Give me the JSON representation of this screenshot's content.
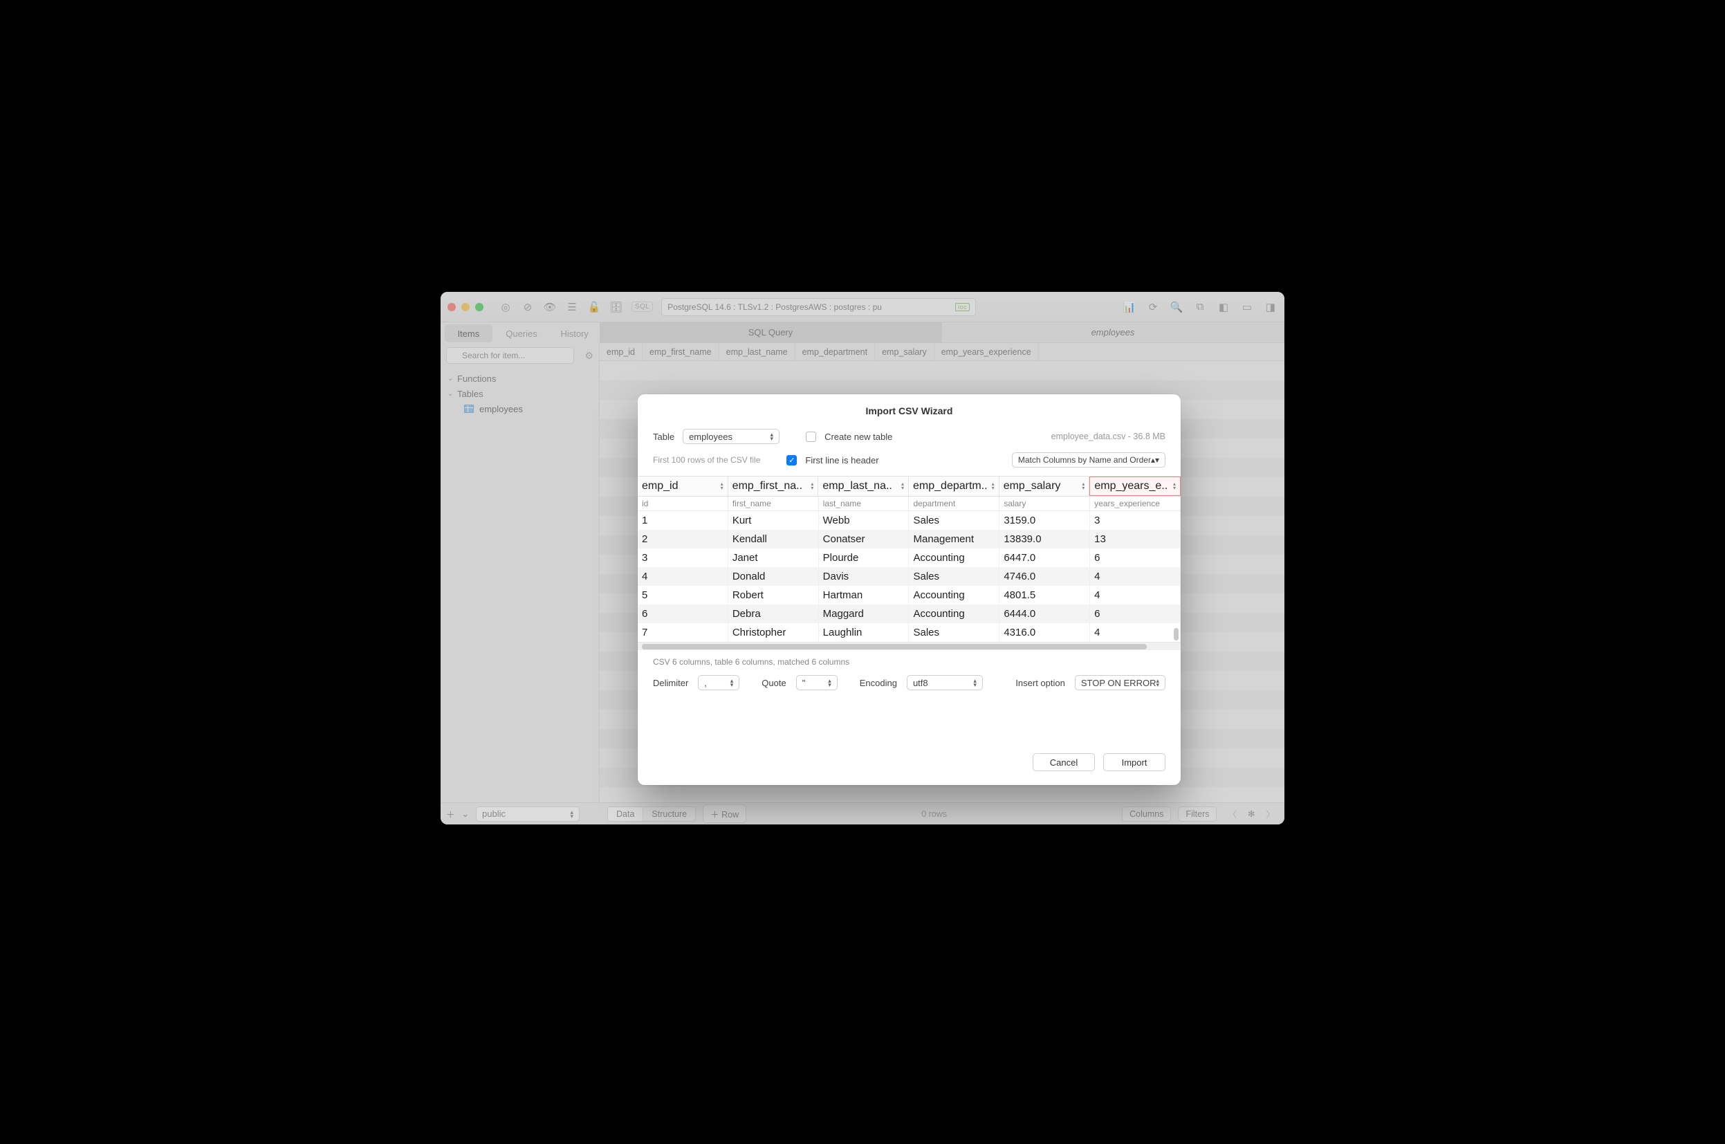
{
  "toolbar": {
    "sql_badge": "SQL",
    "connection": "PostgreSQL 14.6 : TLSv1.2 : PostgresAWS : postgres : pu",
    "loc_badge": "loc"
  },
  "sidebar_tabs": {
    "items": "Items",
    "queries": "Queries",
    "history": "History"
  },
  "main_tabs": {
    "sql_query": "SQL Query",
    "employees": "employees"
  },
  "search": {
    "placeholder": "Search for item..."
  },
  "tree": {
    "functions": "Functions",
    "tables": "Tables",
    "employees": "employees"
  },
  "columns": [
    "emp_id",
    "emp_first_name",
    "emp_last_name",
    "emp_department",
    "emp_salary",
    "emp_years_experience"
  ],
  "footer": {
    "schema": "public",
    "data": "Data",
    "structure": "Structure",
    "row": "Row",
    "rows": "0 rows",
    "columns_btn": "Columns",
    "filters_btn": "Filters"
  },
  "modal": {
    "title": "Import CSV Wizard",
    "table_label": "Table",
    "table_value": "employees",
    "create_new": "Create new table",
    "file_info": "employee_data.csv - 36.8 MB",
    "first100": "First 100 rows of the CSV file",
    "first_line_header": "First line is header",
    "match_columns": "Match Columns by Name and Order",
    "map_target": [
      "emp_id",
      "emp_first_na..",
      "emp_last_na..",
      "emp_departm..",
      "emp_salary",
      "emp_years_e.."
    ],
    "map_source": [
      "id",
      "first_name",
      "last_name",
      "department",
      "salary",
      "years_experience"
    ],
    "rows": [
      [
        "1",
        "Kurt",
        "Webb",
        "Sales",
        "3159.0",
        "3"
      ],
      [
        "2",
        "Kendall",
        "Conatser",
        "Management",
        "13839.0",
        "13"
      ],
      [
        "3",
        "Janet",
        "Plourde",
        "Accounting",
        "6447.0",
        "6"
      ],
      [
        "4",
        "Donald",
        "Davis",
        "Sales",
        "4746.0",
        "4"
      ],
      [
        "5",
        "Robert",
        "Hartman",
        "Accounting",
        "4801.5",
        "4"
      ],
      [
        "6",
        "Debra",
        "Maggard",
        "Accounting",
        "6444.0",
        "6"
      ],
      [
        "7",
        "Christopher",
        "Laughlin",
        "Sales",
        "4316.0",
        "4"
      ]
    ],
    "summary": "CSV 6 columns, table 6 columns, matched 6 columns",
    "delimiter_label": "Delimiter",
    "delimiter_value": ",",
    "quote_label": "Quote",
    "quote_value": "\"",
    "encoding_label": "Encoding",
    "encoding_value": "utf8",
    "insert_label": "Insert option",
    "insert_value": "STOP ON ERROR",
    "cancel": "Cancel",
    "import": "Import"
  }
}
